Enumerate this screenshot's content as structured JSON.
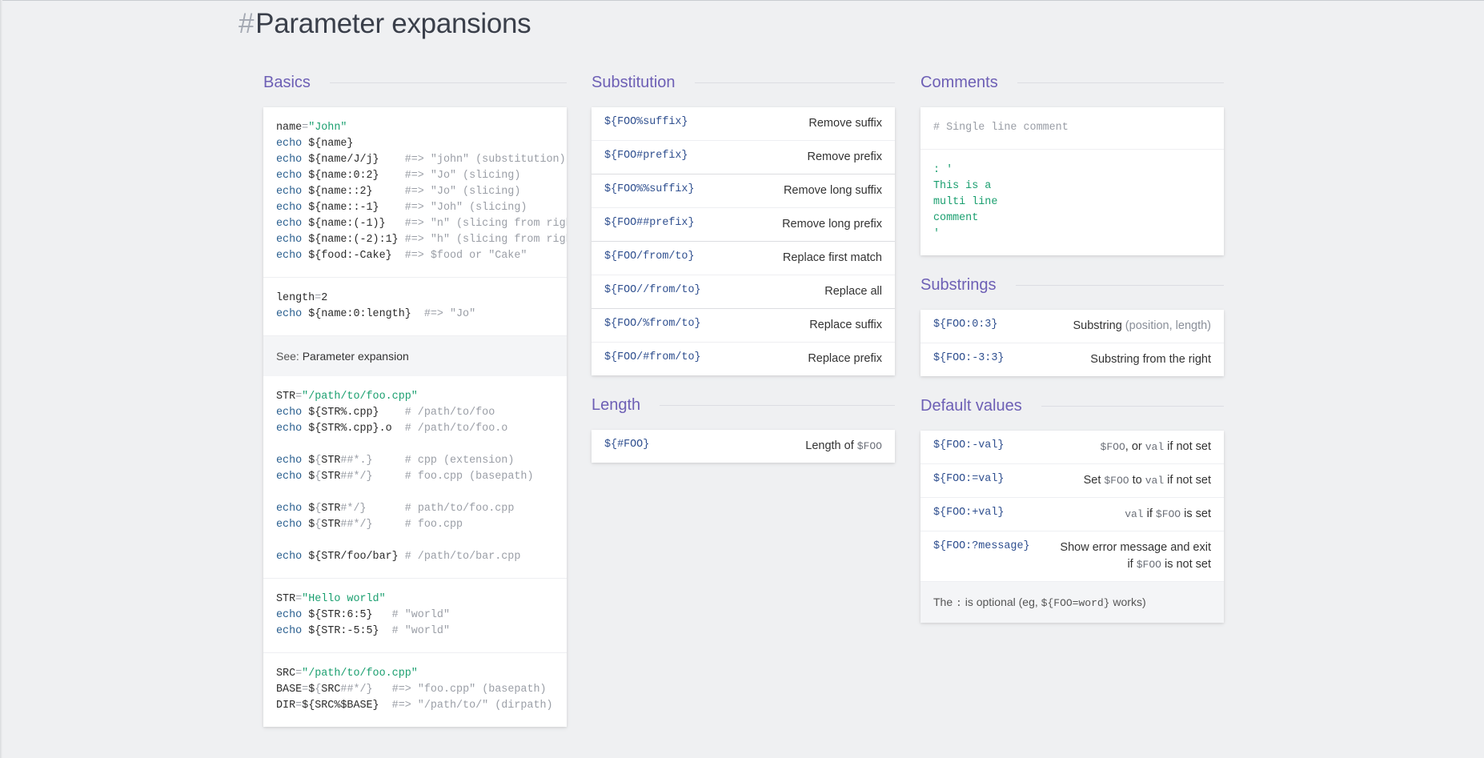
{
  "page": {
    "hash": "#",
    "title": "Parameter expansions"
  },
  "basics": {
    "title": "Basics",
    "note_prefix": "See:",
    "note_link": "Parameter expansion"
  },
  "substitution": {
    "title": "Substitution",
    "rows": [
      {
        "code": "${FOO%suffix}",
        "desc": "Remove suffix"
      },
      {
        "code": "${FOO#prefix}",
        "desc": "Remove prefix"
      },
      {
        "code": "${FOO%%suffix}",
        "desc": "Remove long suffix"
      },
      {
        "code": "${FOO##prefix}",
        "desc": "Remove long prefix"
      },
      {
        "code": "${FOO/from/to}",
        "desc": "Replace first match"
      },
      {
        "code": "${FOO//from/to}",
        "desc": "Replace all"
      },
      {
        "code": "${FOO/%from/to}",
        "desc": "Replace suffix"
      },
      {
        "code": "${FOO/#from/to}",
        "desc": "Replace prefix"
      }
    ]
  },
  "length": {
    "title": "Length",
    "code": "${#FOO}",
    "desc": "Length of",
    "desc_code": "$FOO"
  },
  "comments": {
    "title": "Comments",
    "single": "# Single line comment"
  },
  "substrings": {
    "title": "Substrings",
    "rows": [
      {
        "code": "${FOO:0:3}",
        "desc": "Substring",
        "muted": "(position, length)"
      },
      {
        "code": "${FOO:-3:3}",
        "desc": "Substring from the right",
        "muted": ""
      }
    ]
  },
  "defaults": {
    "title": "Default values",
    "r1_code": "${FOO:-val}",
    "r1_a": "$FOO",
    "r1_b": ", or ",
    "r1_c": "val",
    "r1_d": " if not set",
    "r2_code": "${FOO:=val}",
    "r2_a": "Set ",
    "r2_b": "$FOO",
    "r2_c": " to ",
    "r2_d": "val",
    "r2_e": " if not set",
    "r3_code": "${FOO:+val}",
    "r3_a": "val",
    "r3_b": " if ",
    "r3_c": "$FOO",
    "r3_d": " is set",
    "r4_code": "${FOO:?message}",
    "r4_a": "Show error message and exit",
    "r4_b": "if ",
    "r4_c": "$FOO",
    "r4_d": " is not set",
    "note_a": "The ",
    "note_b": ":",
    "note_c": " is optional (eg, ",
    "note_d": "${FOO=word}",
    "note_e": " works)"
  }
}
